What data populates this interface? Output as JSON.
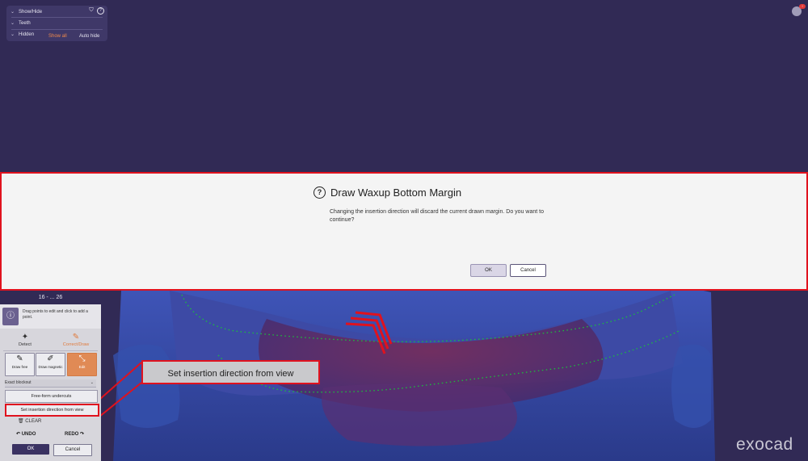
{
  "showhide": {
    "title": "Show/Hide",
    "row_teeth": "Teeth",
    "row_hidden": "Hidden",
    "show_all": "Show all",
    "auto_hide": "Auto hide"
  },
  "notification": {
    "badge": "!"
  },
  "dialog": {
    "title": "Draw Waxup Bottom Margin",
    "message": "Changing the insertion direction will discard the current drawn margin. Do you want to continue?",
    "ok_label": "OK",
    "cancel_label": "Cancel"
  },
  "tool_panel": {
    "header": "16 - ... 26",
    "info_text": "Drag points to edit and click to add a point.",
    "mode_detect": "Detect",
    "mode_correct": "Correct/Draw",
    "draw_free": "Draw free",
    "draw_magnetic": "Draw magnetic",
    "edit": "Edit",
    "blockout_select": "Exact blockout",
    "freeform_button": "Free-form undercuts",
    "set_insertion_button": "Set insertion direction from view",
    "clear": "CLEAR",
    "undo": "UNDO",
    "redo": "REDO",
    "ok": "OK",
    "cancel": "Cancel"
  },
  "callout": {
    "text": "Set insertion direction from view"
  },
  "brand": {
    "logo": "exocad"
  },
  "colors": {
    "background": "#312a55",
    "highlight_red": "#e0121e",
    "accent_orange": "#e07a3c",
    "model_blue": "#3a4ea8",
    "margin_green": "#19c23a"
  }
}
